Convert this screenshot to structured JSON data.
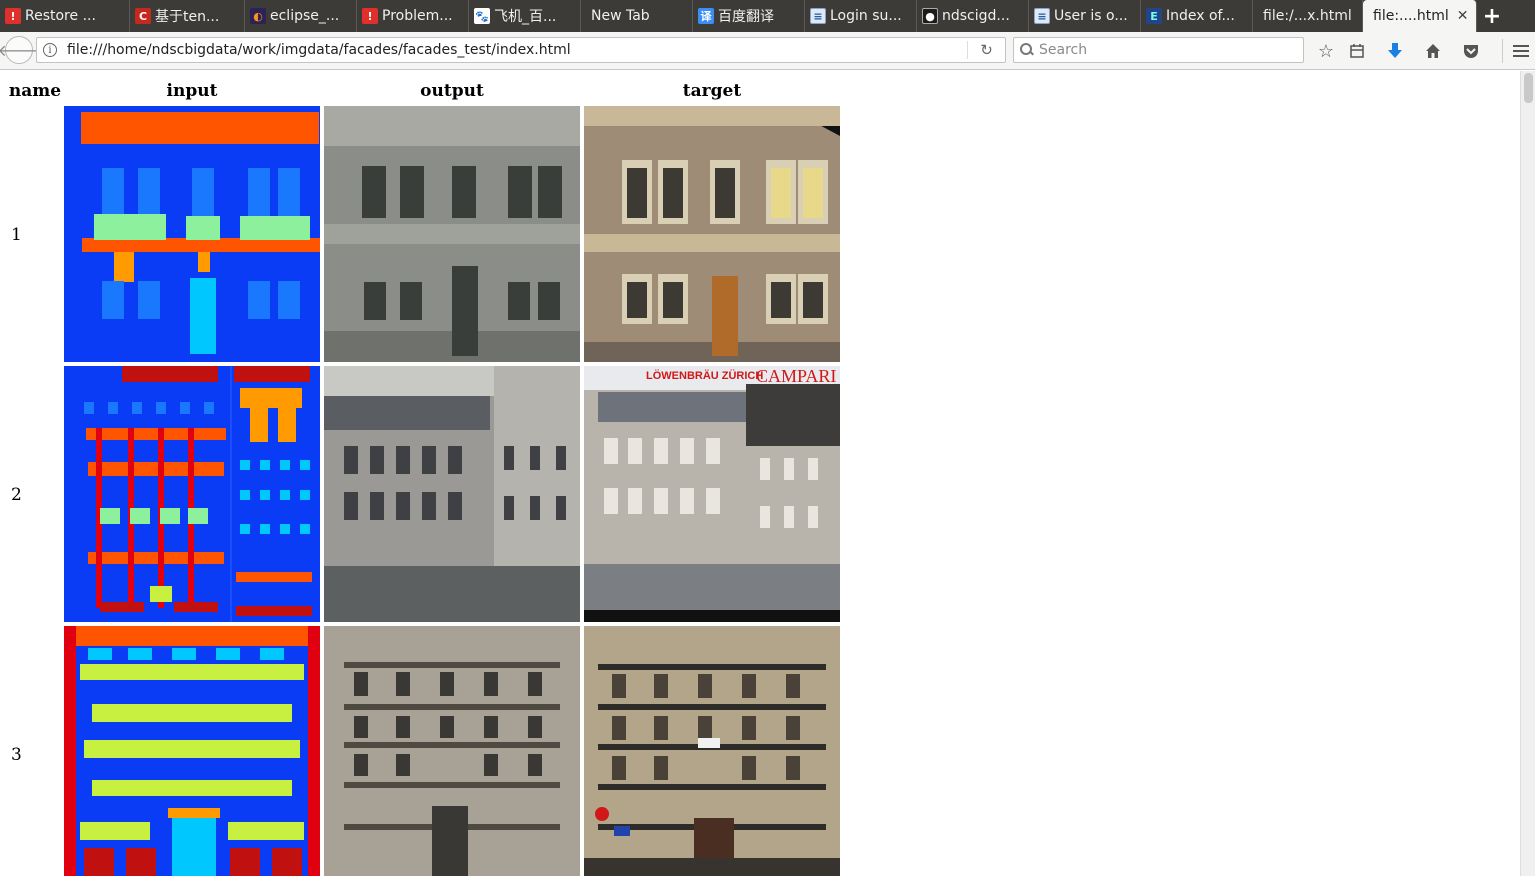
{
  "tabs": [
    {
      "label": "Restore ...",
      "icon": "error-icon"
    },
    {
      "label": "基于ten...",
      "icon": "csdn-icon"
    },
    {
      "label": "eclipse_...",
      "icon": "eclipse-icon"
    },
    {
      "label": "Problem...",
      "icon": "error-icon"
    },
    {
      "label": "飞机_百...",
      "icon": "baidu-icon"
    },
    {
      "label": "New Tab",
      "icon": ""
    },
    {
      "label": "百度翻译",
      "icon": "fanyi-icon"
    },
    {
      "label": "Login su...",
      "icon": "document-icon"
    },
    {
      "label": "ndscigd...",
      "icon": "github-icon"
    },
    {
      "label": "User is o...",
      "icon": "document-icon"
    },
    {
      "label": "Index of...",
      "icon": "index-icon"
    },
    {
      "label": "file:/...x.html",
      "icon": ""
    },
    {
      "label": "file:....html",
      "icon": "",
      "active": true
    }
  ],
  "navbar": {
    "url": "file:///home/ndscbigdata/work/imgdata/facades/facades_test/index.html",
    "search_placeholder": "Search"
  },
  "table": {
    "headers": [
      "name",
      "input",
      "output",
      "target"
    ],
    "rows": [
      {
        "name": "1"
      },
      {
        "name": "2"
      },
      {
        "name": "3"
      }
    ]
  },
  "colors": {
    "label_blue": "#0a3cf6",
    "label_orange": "#ff5500",
    "label_lightgreen": "#8cf09c",
    "label_cyan": "#00c8ff",
    "label_red": "#e00010",
    "label_yellowgreen": "#c8f040"
  }
}
